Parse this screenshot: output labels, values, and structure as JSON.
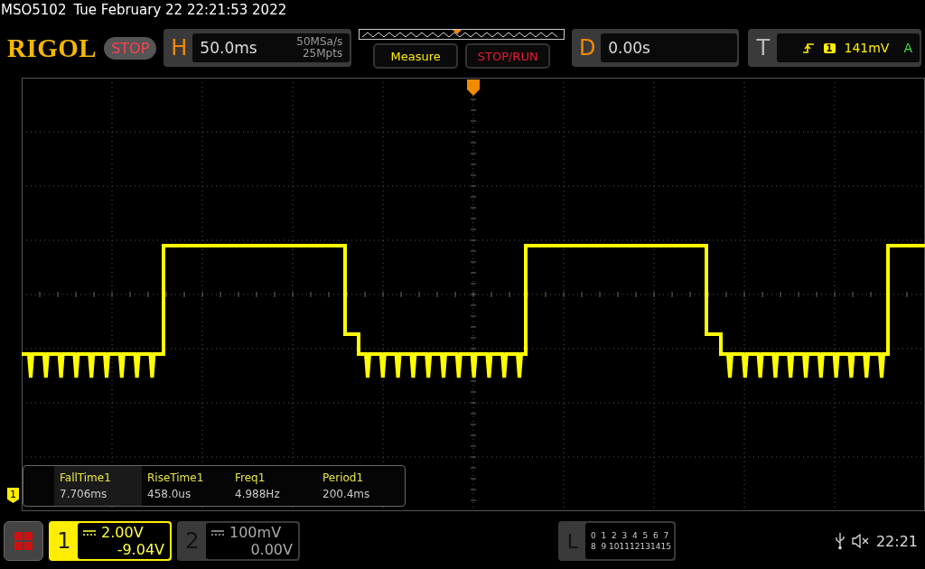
{
  "status_line": {
    "model": "MSO5102",
    "datetime": "Tue February 22 22:21:53 2022"
  },
  "toolbar": {
    "logo": "RIGOL",
    "run_state": "STOP",
    "horizontal": {
      "label": "H",
      "timebase": "50.0ms",
      "sample_rate": "50MSa/s",
      "memory_depth": "25Mpts"
    },
    "buttons": [
      {
        "label": "Measure",
        "kind": "measure"
      },
      {
        "label": "STOP/RUN",
        "kind": "run"
      }
    ],
    "delay": {
      "label": "D",
      "value": "0.00s"
    },
    "trigger": {
      "label": "T",
      "source": "1",
      "threshold": "141mV",
      "mode": "A"
    }
  },
  "measurements": [
    {
      "name": "FallTime1",
      "value": "7.706ms",
      "selected": true
    },
    {
      "name": "RiseTime1",
      "value": "458.0us",
      "selected": false
    },
    {
      "name": "Freq1",
      "value": "4.988Hz",
      "selected": false
    },
    {
      "name": "Period1",
      "value": "200.4ms",
      "selected": false
    }
  ],
  "channel_marker": "1",
  "channels": [
    {
      "number": "1",
      "scale": "2.00V",
      "offset": "-9.04V",
      "active": true
    },
    {
      "number": "2",
      "scale": "100mV",
      "offset": "0.00V",
      "active": false
    }
  ],
  "logic": {
    "label": "L",
    "channels": [
      "0",
      "1",
      "2",
      "3",
      "4",
      "5",
      "6",
      "7",
      "8",
      "9",
      "10",
      "11",
      "12",
      "13",
      "14",
      "15"
    ]
  },
  "clock": "22:21"
}
